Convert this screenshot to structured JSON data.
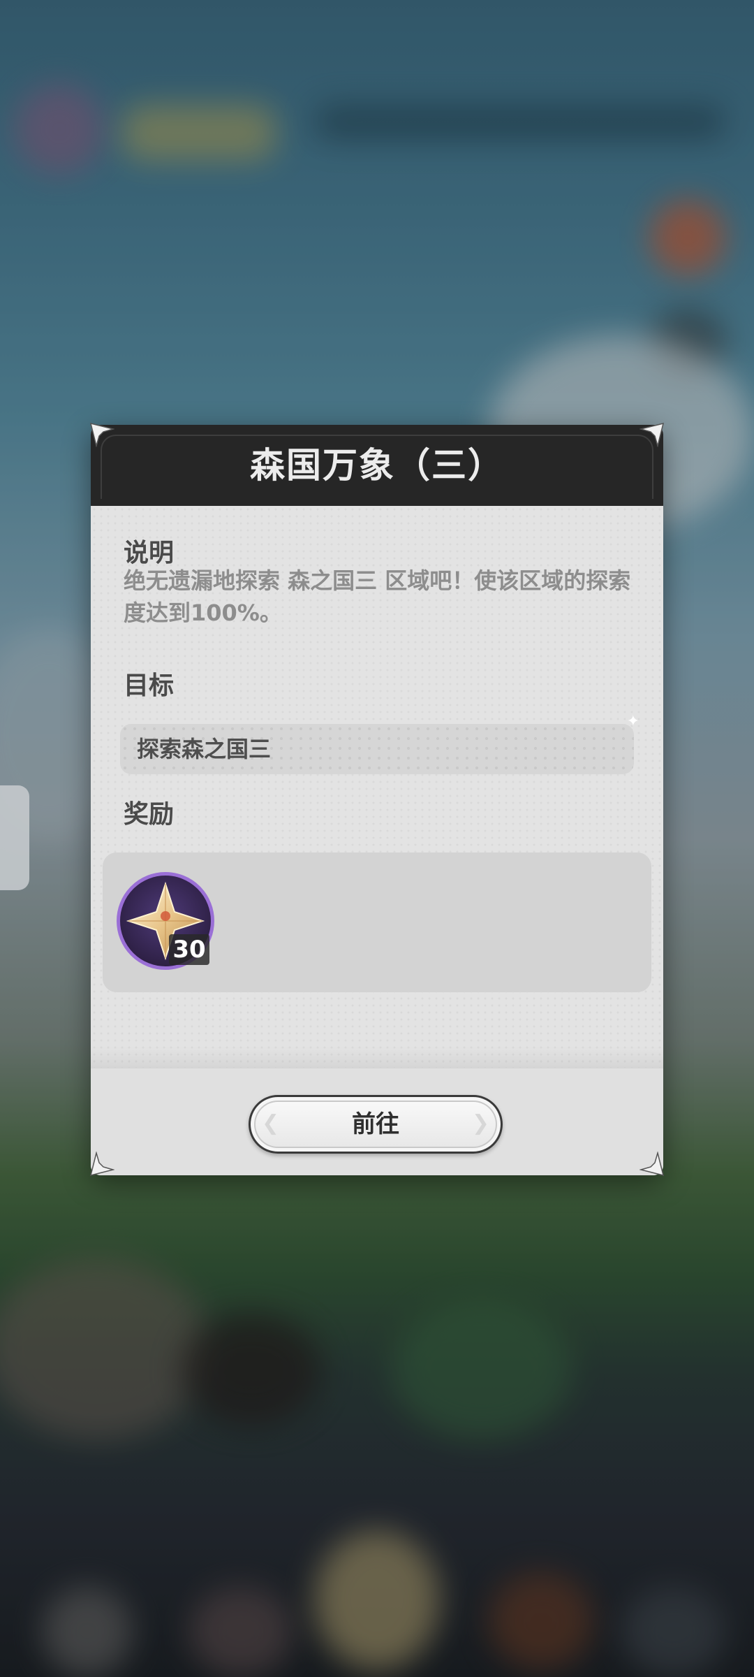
{
  "dialog": {
    "title": "森国万象（三）",
    "description_label": "说明",
    "description_text": "绝无遗漏地探索 森之国三 区域吧！使该区域的探索度达到100%。",
    "goal_label": "目标",
    "goal_text": "探索森之国三",
    "reward_label": "奖励",
    "rewards": [
      {
        "icon": "primogem-icon",
        "count": "30"
      }
    ],
    "go_button_label": "前往"
  },
  "colors": {
    "header_bg": "#262626",
    "panel_bg": "#e3e3e3",
    "reward_frame": "#9a6fd6",
    "reward_bg": "#2f2147"
  }
}
